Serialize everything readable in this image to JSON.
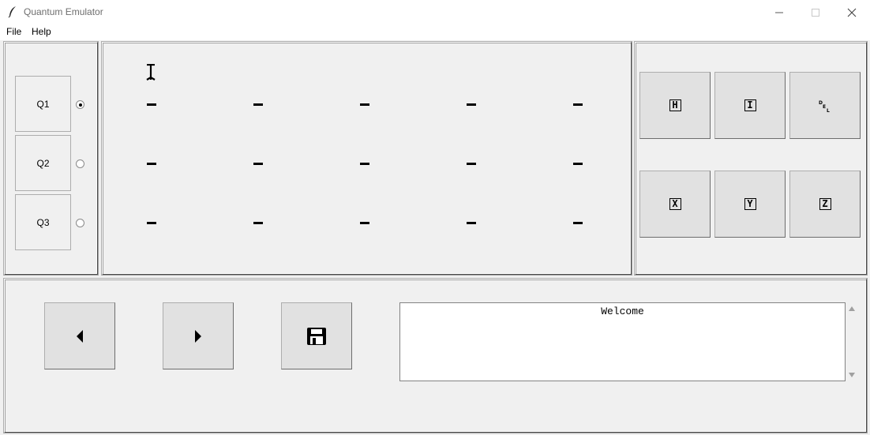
{
  "window": {
    "title": "Quantum Emulator",
    "app_icon": "feather-icon",
    "controls": [
      "minimize-icon",
      "maximize-icon",
      "close-icon"
    ]
  },
  "menu": {
    "file": "File",
    "help": "Help"
  },
  "qubits": [
    {
      "label": "Q1",
      "selected": true
    },
    {
      "label": "Q2",
      "selected": false
    },
    {
      "label": "Q3",
      "selected": false
    }
  ],
  "circuit": {
    "cursor_icon": "insert-cursor-icon",
    "rows": 3,
    "cols": 5,
    "empty_slot_icon": "dash-icon"
  },
  "gates": [
    {
      "label": "H",
      "icon": "gate-h-icon"
    },
    {
      "label": "I",
      "icon": "gate-i-icon"
    },
    {
      "label": "DEL",
      "icon": "delete-icon"
    },
    {
      "label": "X",
      "icon": "gate-x-icon"
    },
    {
      "label": "Y",
      "icon": "gate-y-icon"
    },
    {
      "label": "Z",
      "icon": "gate-z-icon"
    }
  ],
  "controls": {
    "prev_icon": "triangle-left-icon",
    "next_icon": "triangle-right-icon",
    "save_icon": "floppy-disk-icon"
  },
  "output": {
    "text": "Welcome"
  },
  "colors": {
    "background": "#f0f0f0",
    "button_face": "#e1e1e1",
    "titlebar": "#ffffff"
  }
}
